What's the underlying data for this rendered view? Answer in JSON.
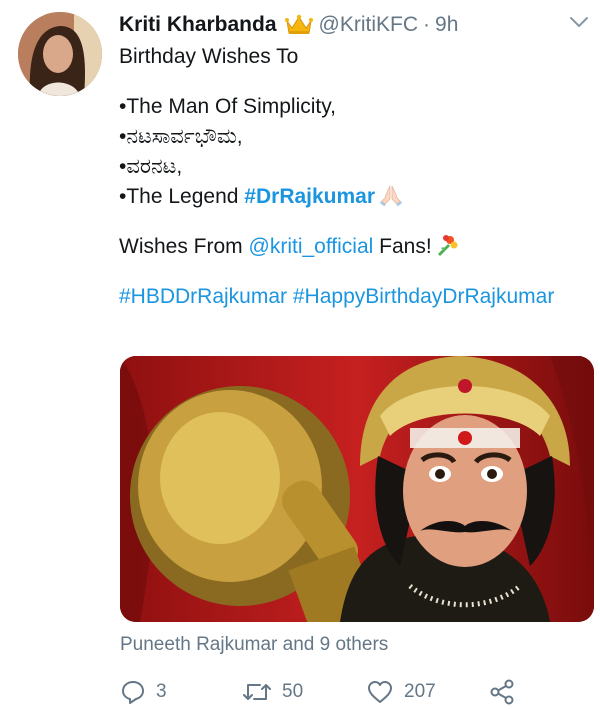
{
  "tweet": {
    "author_name": "Kriti Kharbanda",
    "author_badge": "crown-emoji",
    "handle": "@KritiKFC",
    "separator": "·",
    "time": "9h",
    "lines": {
      "l1": "Birthday Wishes To",
      "l2": "•The Man Of Simplicity,",
      "l3": "•ನಟಸಾರ್ವಭೌಮ,",
      "l4": "•ವರನಟ,",
      "l5_prefix": "•The Legend ",
      "l5_hashtag": "#DrRajkumar",
      "l6_prefix": "Wishes From ",
      "l6_mention": "@kriti_official",
      "l6_suffix": " Fans!",
      "hashtag_1": "#HBDDrRajkumar",
      "hashtag_2": "#HappyBirthdayDrRajkumar"
    },
    "liked_by": "Puneeth Rajkumar and 9 others",
    "reply_count": "3",
    "retweet_count": "50",
    "like_count": "207"
  },
  "icons": [
    "crown-icon",
    "praying-hands-icon",
    "bouquet-icon",
    "chevron-down-icon",
    "reply-icon",
    "retweet-icon",
    "like-icon",
    "share-icon"
  ],
  "colors": {
    "link": "#1b95e0",
    "secondary": "#657786",
    "text": "#14171a"
  }
}
